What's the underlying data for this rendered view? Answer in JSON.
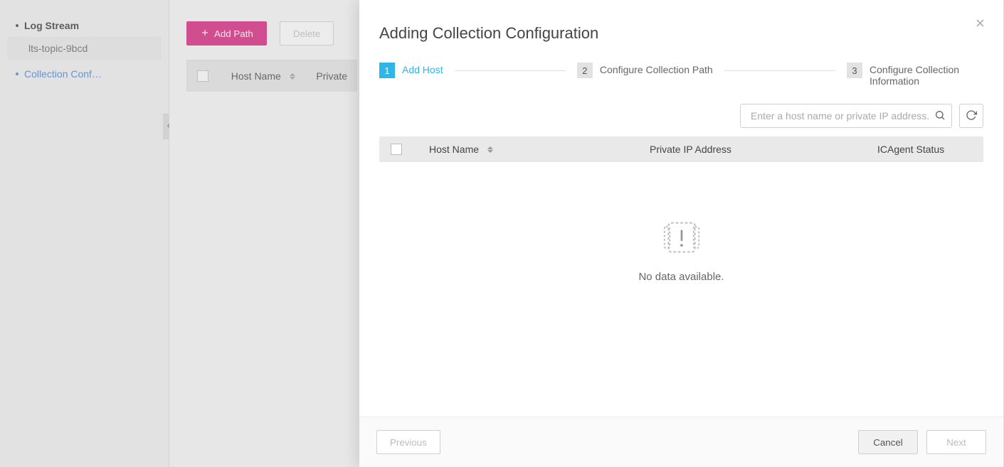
{
  "sidebar": {
    "groups": [
      {
        "label": "Log Stream",
        "active": false,
        "items": [
          "lts-topic-9bcd"
        ]
      },
      {
        "label": "Collection Conf…",
        "active": true,
        "items": []
      }
    ]
  },
  "toolbar": {
    "add_path_label": "Add Path",
    "delete_label": "Delete"
  },
  "bg_table": {
    "columns": [
      "Host Name",
      "Private"
    ]
  },
  "modal": {
    "title": "Adding Collection Configuration",
    "steps": [
      {
        "label": "Add Host"
      },
      {
        "label": "Configure Collection Path"
      },
      {
        "label": "Configure Collection Information"
      }
    ],
    "search": {
      "placeholder": "Enter a host name or private IP address."
    },
    "columns": {
      "host_name": "Host Name",
      "private_ip": "Private IP Address",
      "icagent": "ICAgent Status"
    },
    "empty_message": "No data available.",
    "footer": {
      "previous": "Previous",
      "cancel": "Cancel",
      "next": "Next"
    }
  }
}
